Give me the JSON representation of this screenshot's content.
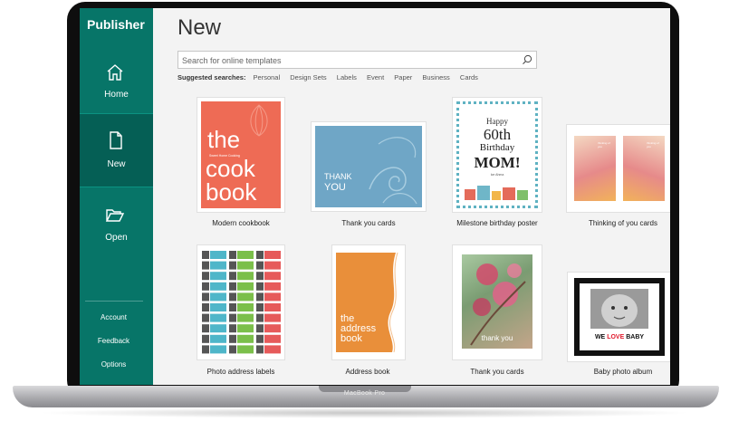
{
  "sidebar": {
    "app_title": "Publisher",
    "nav": {
      "home": "Home",
      "new": "New",
      "open": "Open"
    },
    "bottom": {
      "account": "Account",
      "feedback": "Feedback",
      "options": "Options"
    }
  },
  "main": {
    "title": "New",
    "search": {
      "placeholder": "Search for online templates"
    },
    "suggested_label": "Suggested searches:",
    "suggested": [
      "Personal",
      "Design Sets",
      "Labels",
      "Event",
      "Paper",
      "Business",
      "Cards"
    ]
  },
  "templates": [
    {
      "label": "Modern cookbook",
      "thumb": {
        "big1": "the",
        "small": "Sweet Home Cooking",
        "big2": "cook",
        "big3": "book"
      }
    },
    {
      "label": "Thank you cards",
      "thumb": {
        "line1": "THANK",
        "line2": "YOU"
      }
    },
    {
      "label": "Milestone birthday poster",
      "thumb": {
        "line1": "Happy",
        "line2": "60th",
        "line3": "Birthday",
        "line4": "MOM!",
        "small": "Ice Ahma"
      }
    },
    {
      "label": "Thinking of you cards",
      "thumb": {
        "t1": "thinking of you",
        "t2": "thinking of you"
      }
    },
    {
      "label": "Photo address labels"
    },
    {
      "label": "Address book",
      "thumb": {
        "line1": "the",
        "line2": "address",
        "line3": "book"
      }
    },
    {
      "label": "Thank you cards",
      "thumb": {
        "text": "thank you"
      }
    },
    {
      "label": "Baby photo album",
      "thumb": {
        "text_a": "WE",
        "text_b": "LOVE",
        "text_c": "BABY"
      }
    }
  ],
  "device": {
    "label": "MacBook Pro"
  },
  "colors": {
    "sidebar": "#077568",
    "sidebar_active": "#055f55",
    "cookbook": "#ee6b55",
    "address_book": "#e98f3a",
    "love": "#e0182b"
  }
}
